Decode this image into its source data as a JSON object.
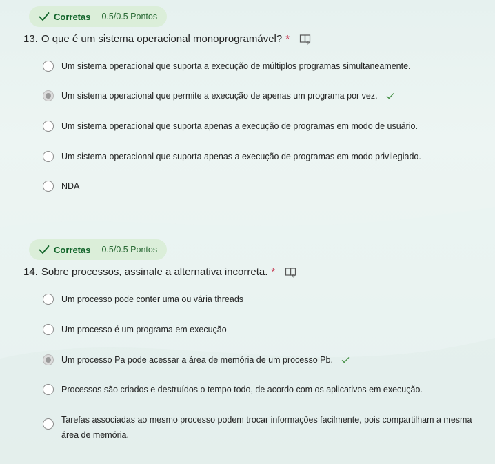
{
  "questions": [
    {
      "status": "Corretas",
      "points": "0.5/0.5 Pontos",
      "number": "13.",
      "title": "O que é um sistema operacional monoprogramável?",
      "required_mark": "*",
      "options": [
        {
          "text": "Um sistema operacional que suporta a execução de múltiplos programas simultaneamente.",
          "selected": false,
          "correct": false
        },
        {
          "text": "Um sistema operacional que permite a execução de apenas um programa por vez.",
          "selected": true,
          "correct": true
        },
        {
          "text": "Um sistema operacional que suporta apenas a execução de programas em modo de usuário.",
          "selected": false,
          "correct": false
        },
        {
          "text": "Um sistema operacional que suporta apenas a execução de programas em modo privilegiado.",
          "selected": false,
          "correct": false
        },
        {
          "text": "NDA",
          "selected": false,
          "correct": false
        }
      ]
    },
    {
      "status": "Corretas",
      "points": "0.5/0.5 Pontos",
      "number": "14.",
      "title": "Sobre processos, assinale a alternativa incorreta.",
      "required_mark": "*",
      "options": [
        {
          "text": "Um processo pode conter uma ou vária threads",
          "selected": false,
          "correct": false
        },
        {
          "text": "Um processo é um programa em execução",
          "selected": false,
          "correct": false
        },
        {
          "text": "Um processo Pa pode acessar a área de memória de um processo Pb.",
          "selected": true,
          "correct": true
        },
        {
          "text": "Processos são criados e destruídos o tempo todo, de acordo com os aplicativos em execução.",
          "selected": false,
          "correct": false
        },
        {
          "text": "Tarefas associadas ao mesmo processo podem trocar informações facilmente, pois compartilham a mesma área de memória.",
          "selected": false,
          "correct": false
        }
      ]
    }
  ],
  "icons": {
    "check": "checkmark-icon",
    "reader": "immersive-reader-icon"
  },
  "colors": {
    "correct_badge_bg": "#dbeed9",
    "correct_text": "#13652b",
    "required": "#c4314b",
    "check_green": "#3a8a3a"
  }
}
